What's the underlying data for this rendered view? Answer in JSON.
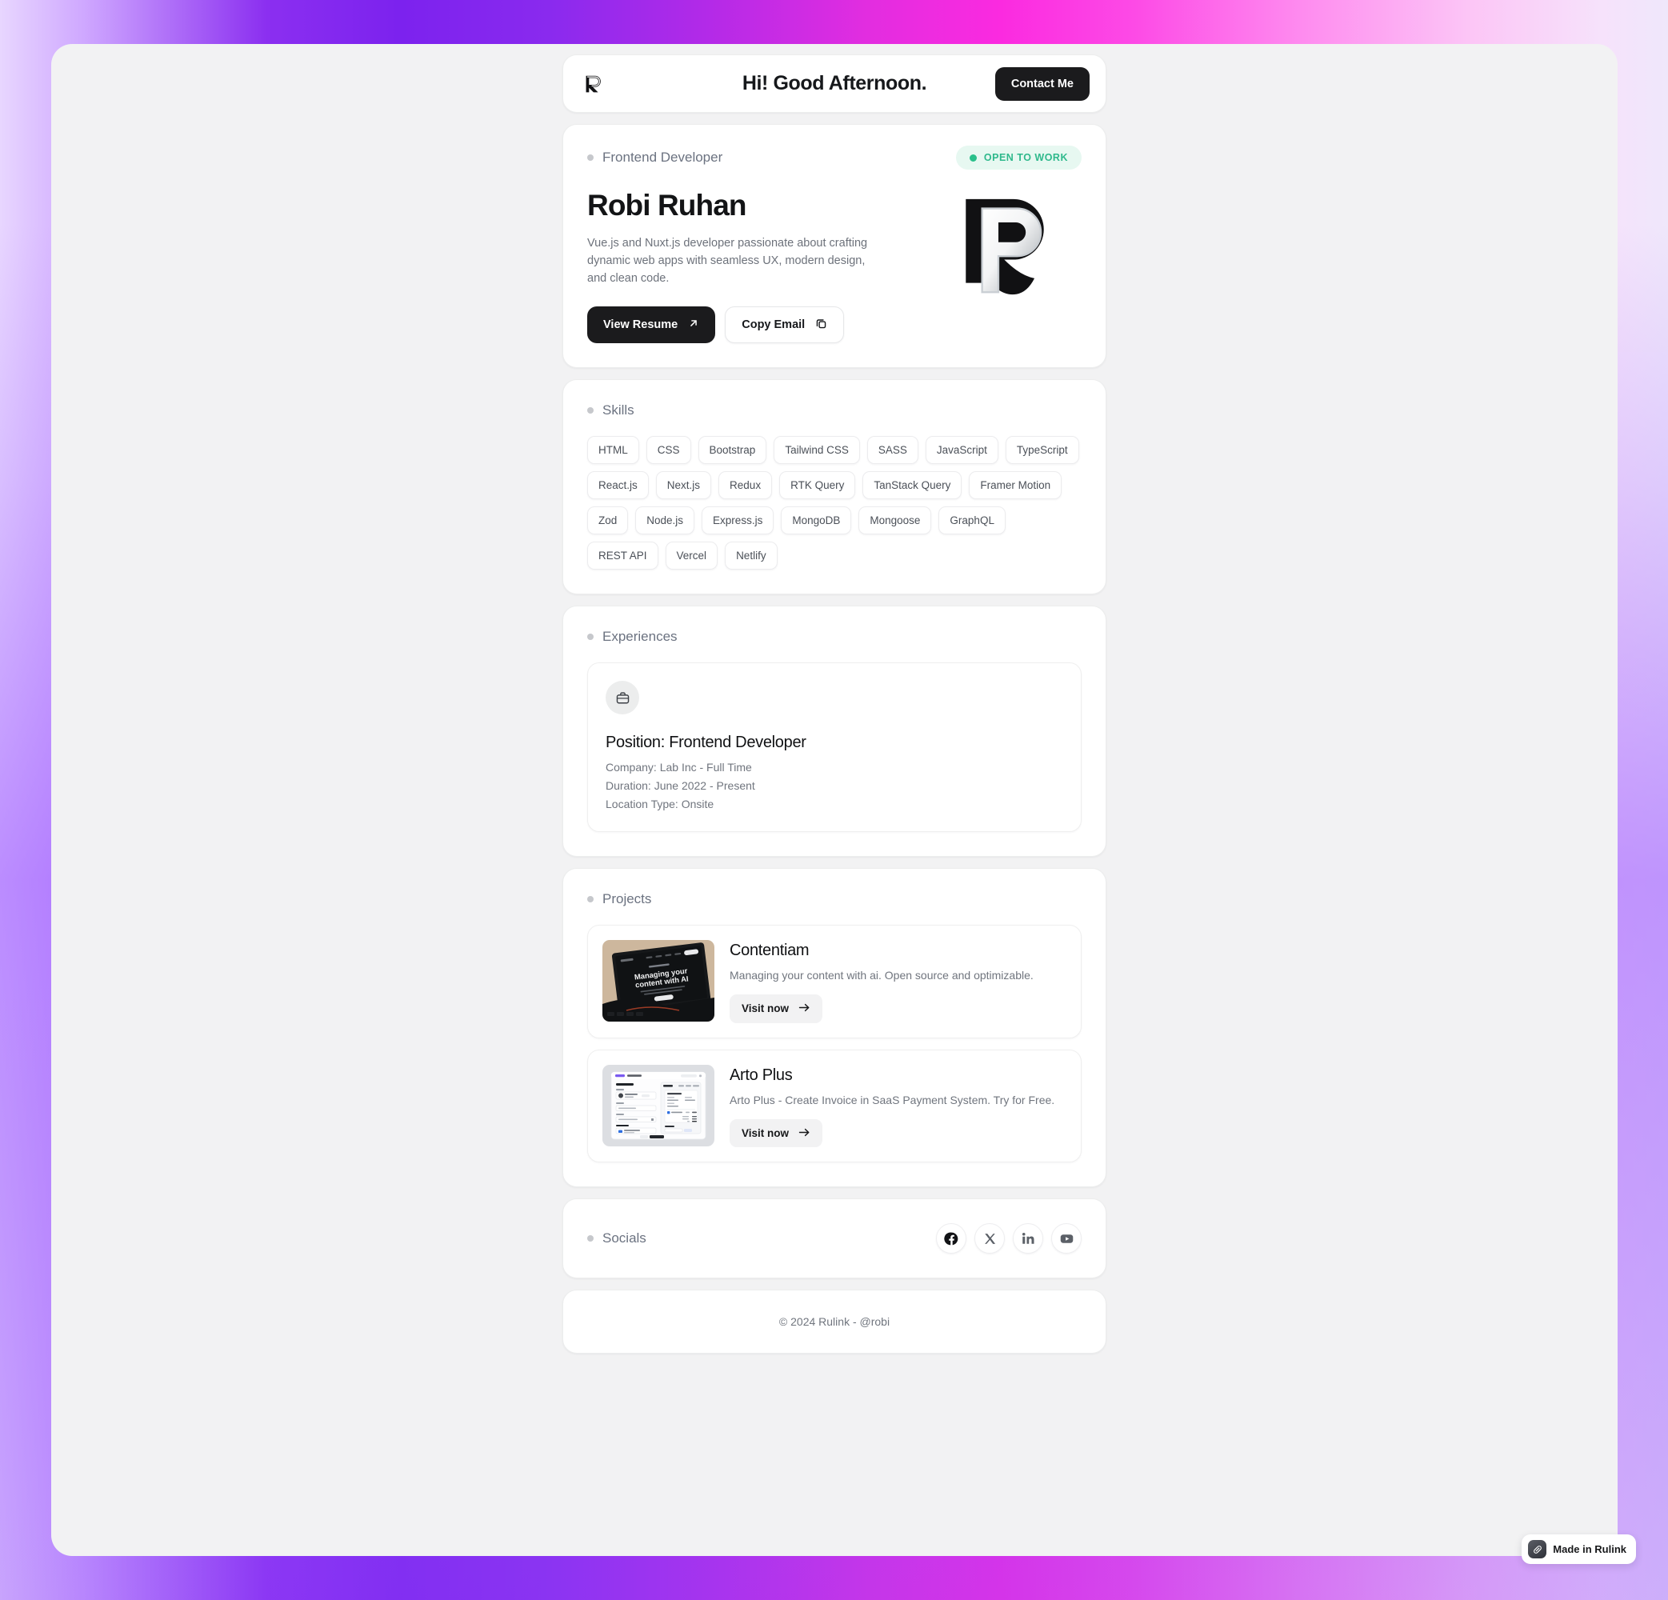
{
  "header": {
    "logo_icon": "rulink-r-logo-icon",
    "greeting": "Hi! Good Afternoon.",
    "contact_label": "Contact Me"
  },
  "hero": {
    "role": "Frontend Developer",
    "status_badge": "OPEN TO WORK",
    "status_color": "#2fb98c",
    "status_bg": "#e7f8f1",
    "name": "Robi Ruhan",
    "bio": "Vue.js and Nuxt.js developer passionate about crafting dynamic web apps with seamless UX, modern design, and clean code.",
    "resume_label": "View Resume",
    "resume_icon": "arrow-up-right-icon",
    "email_label": "Copy Email",
    "email_icon": "copy-icon",
    "avatar_icon": "rulink-r-logo-large-icon"
  },
  "skills": {
    "title": "Skills",
    "items": [
      "HTML",
      "CSS",
      "Bootstrap",
      "Tailwind CSS",
      "SASS",
      "JavaScript",
      "TypeScript",
      "React.js",
      "Next.js",
      "Redux",
      "RTK Query",
      "TanStack Query",
      "Framer Motion",
      "Zod",
      "Node.js",
      "Express.js",
      "MongoDB",
      "Mongoose",
      "GraphQL",
      "REST API",
      "Vercel",
      "Netlify"
    ]
  },
  "experiences": {
    "title": "Experiences",
    "items": [
      {
        "icon": "briefcase-icon",
        "position": "Position: Frontend Developer",
        "company": "Company: Lab Inc - Full Time",
        "duration": "Duration: June 2022 - Present",
        "location": "Location Type: Onsite"
      }
    ]
  },
  "projects": {
    "title": "Projects",
    "items": [
      {
        "name": "Contentiam",
        "description": "Managing your content with ai. Open source and optimizable.",
        "cta": "Visit now",
        "cta_icon": "arrow-right-icon",
        "thumb": "laptop-dark-website-screenshot",
        "thumb_headline": "Managing your content with AI"
      },
      {
        "name": "Arto Plus",
        "description": "Arto Plus - Create Invoice in SaaS Payment System. Try for Free.",
        "cta": "Visit now",
        "cta_icon": "arrow-right-icon",
        "thumb": "invoice-dashboard-screenshot",
        "thumb_headline": ""
      }
    ]
  },
  "socials": {
    "title": "Socials",
    "items": [
      {
        "name": "facebook",
        "icon": "facebook-icon"
      },
      {
        "name": "x",
        "icon": "x-twitter-icon"
      },
      {
        "name": "linkedin",
        "icon": "linkedin-icon"
      },
      {
        "name": "youtube",
        "icon": "youtube-icon"
      }
    ]
  },
  "footer": {
    "text": "© 2024 Rulink - @robi"
  },
  "made_badge": {
    "label": "Made in Rulink",
    "icon": "rulink-link-icon"
  }
}
